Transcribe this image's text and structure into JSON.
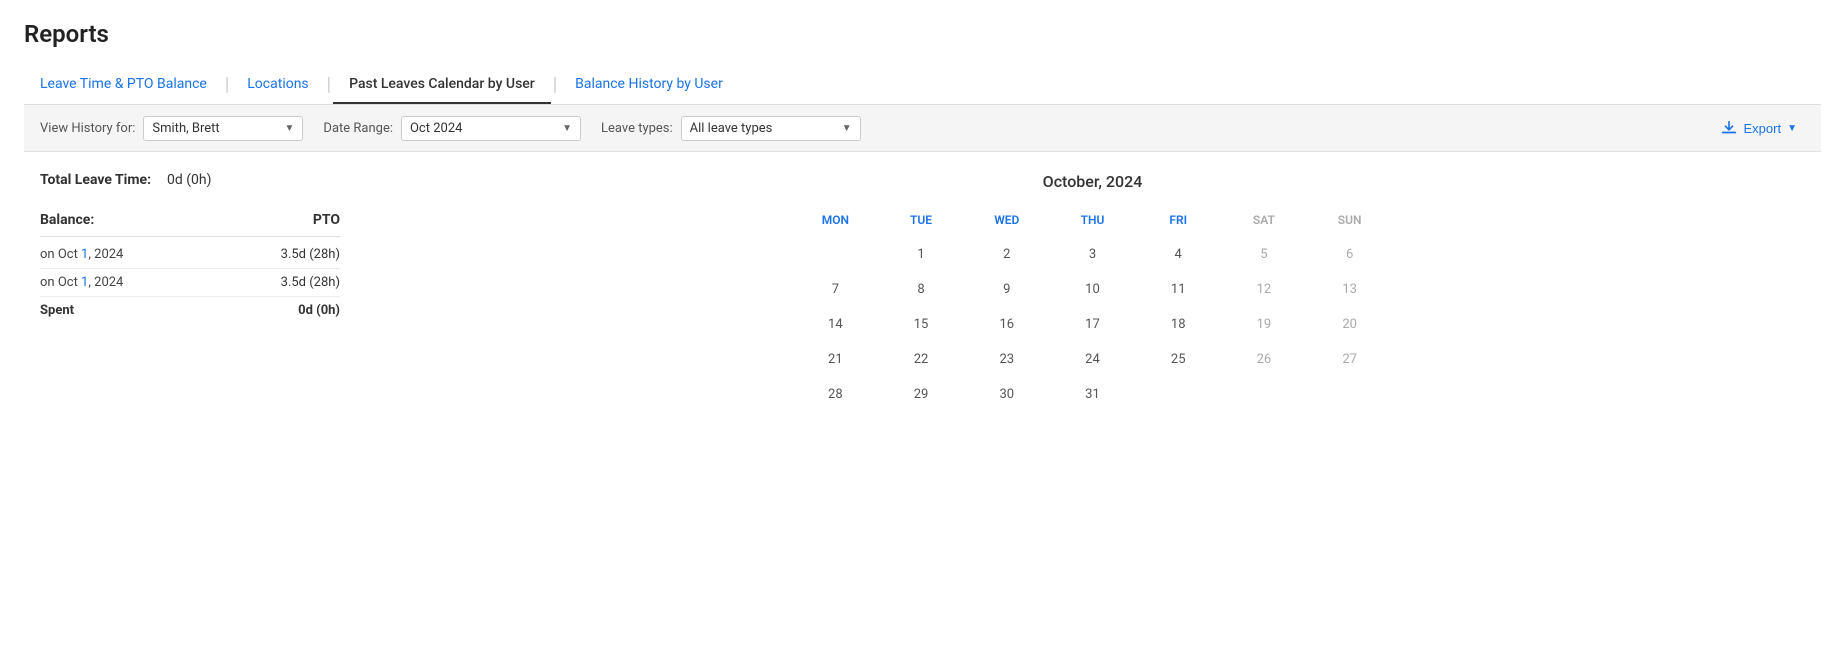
{
  "page": {
    "title": "Reports"
  },
  "tabs": [
    {
      "id": "leave-time",
      "label": "Leave Time & PTO Balance",
      "active": false
    },
    {
      "id": "locations",
      "label": "Locations",
      "active": false
    },
    {
      "id": "past-leaves",
      "label": "Past Leaves Calendar by User",
      "active": true
    },
    {
      "id": "balance-history",
      "label": "Balance History by User",
      "active": false
    }
  ],
  "filters": {
    "view_history_label": "View History for:",
    "user_value": "Smith, Brett",
    "date_range_label": "Date Range:",
    "date_range_value": "Oct 2024",
    "leave_types_label": "Leave types:",
    "leave_types_value": "All leave types",
    "export_label": "Export"
  },
  "summary": {
    "total_leave_label": "Total Leave Time:",
    "total_leave_value": "0d (0h)",
    "balance_label": "Balance:",
    "balance_col": "PTO",
    "rows": [
      {
        "date": "on Oct 1, 2024",
        "value": "3.5d (28h)"
      },
      {
        "date": "on Oct 1, 2024",
        "value": "3.5d (28h)"
      }
    ],
    "spent_label": "Spent",
    "spent_value": "0d (0h)"
  },
  "calendar": {
    "title": "October, 2024",
    "days_of_week": [
      "MON",
      "TUE",
      "WED",
      "THU",
      "FRI",
      "SAT",
      "SUN"
    ],
    "weeks": [
      [
        {
          "day": "",
          "empty": true
        },
        {
          "day": "1",
          "weekend": false
        },
        {
          "day": "2",
          "weekend": false
        },
        {
          "day": "3",
          "weekend": false
        },
        {
          "day": "4",
          "weekend": false
        },
        {
          "day": "5",
          "weekend": true
        },
        {
          "day": "6",
          "weekend": true
        }
      ],
      [
        {
          "day": "7",
          "weekend": false
        },
        {
          "day": "8",
          "weekend": false
        },
        {
          "day": "9",
          "weekend": false
        },
        {
          "day": "10",
          "weekend": false
        },
        {
          "day": "11",
          "weekend": false
        },
        {
          "day": "12",
          "weekend": true
        },
        {
          "day": "13",
          "weekend": true
        }
      ],
      [
        {
          "day": "14",
          "weekend": false
        },
        {
          "day": "15",
          "weekend": false
        },
        {
          "day": "16",
          "weekend": false
        },
        {
          "day": "17",
          "weekend": false
        },
        {
          "day": "18",
          "weekend": false
        },
        {
          "day": "19",
          "weekend": true
        },
        {
          "day": "20",
          "weekend": true
        }
      ],
      [
        {
          "day": "21",
          "weekend": false
        },
        {
          "day": "22",
          "weekend": false
        },
        {
          "day": "23",
          "weekend": false
        },
        {
          "day": "24",
          "weekend": false
        },
        {
          "day": "25",
          "weekend": false
        },
        {
          "day": "26",
          "weekend": true
        },
        {
          "day": "27",
          "weekend": true
        }
      ],
      [
        {
          "day": "28",
          "weekend": false
        },
        {
          "day": "29",
          "weekend": false
        },
        {
          "day": "30",
          "weekend": false
        },
        {
          "day": "31",
          "weekend": false
        },
        {
          "day": "",
          "empty": true
        },
        {
          "day": "",
          "empty": true
        },
        {
          "day": "",
          "empty": true
        }
      ]
    ]
  }
}
